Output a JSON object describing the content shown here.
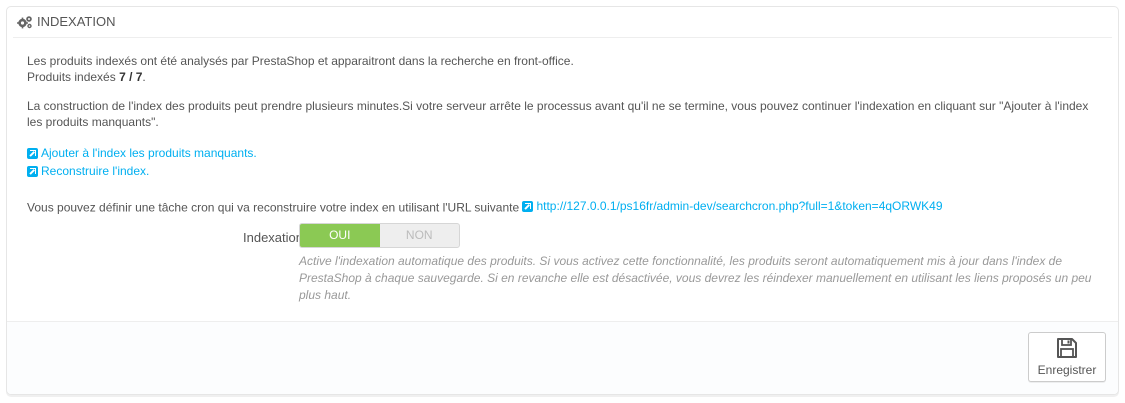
{
  "heading": {
    "title": "INDEXATION",
    "icon": "cogs-icon"
  },
  "info": {
    "line1": "Les produits indexés ont été analysés par PrestaShop et apparaitront dans la recherche en front-office.",
    "line2_prefix": "Produits indexés ",
    "line2_count": "7 / 7",
    "line2_suffix": "."
  },
  "notice": "La construction de l'index des produits peut prendre plusieurs minutes.Si votre serveur arrête le processus avant qu'il ne se termine, vous pouvez continuer l'indexation en cliquant sur \"Ajouter à l'index les produits manquants\".",
  "links": {
    "add_missing": "Ajouter à l'index les produits manquants.",
    "rebuild": "Reconstruire l'index."
  },
  "cron": {
    "text": "Vous pouvez définir une tâche cron qui va reconstruire votre index en utilisant l'URL suivante",
    "url": "http://127.0.0.1/ps16fr/admin-dev/searchcron.php?full=1&token=4qORWK49"
  },
  "form": {
    "label": "Indexation",
    "switch_on": "OUI",
    "switch_off": "NON",
    "selected": "OUI",
    "help": "Active l'indexation automatique des produits. Si vous activez cette fonctionnalité, les produits seront automatiquement mis à jour dans l'index de PrestaShop à chaque sauvegarde. Si en revanche elle est désactivée, vous devrez les réindexer manuellement en utilisant les liens proposés un peu plus haut."
  },
  "footer": {
    "save_label": "Enregistrer",
    "save_icon": "floppy-disk-icon"
  },
  "colors": {
    "link": "#00aff0",
    "switch_on": "#8bc954"
  }
}
